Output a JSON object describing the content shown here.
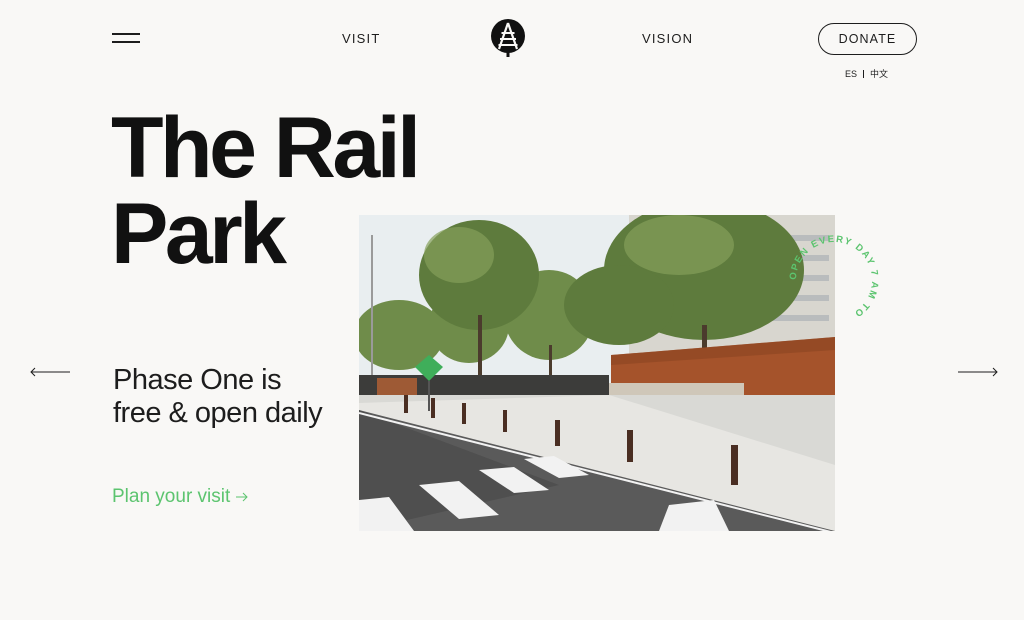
{
  "nav": {
    "visit": "VISIT",
    "vision": "VISION",
    "donate": "DONATE",
    "menu_icon": "hamburger-icon",
    "logo_icon": "rail-park-logo-icon"
  },
  "languages": [
    "ES",
    "中文"
  ],
  "hero": {
    "title_line1": "The Rail",
    "title_line2": "Park",
    "subheading": "Phase One is free & open daily",
    "cta": "Plan your visit"
  },
  "badge": {
    "text": "OPEN EVERY DAY 7 AM TO "
  },
  "colors": {
    "background": "#f9f8f6",
    "text": "#1d1d1d",
    "accent": "#5cc46f"
  },
  "icons": {
    "prev": "arrow-left-icon",
    "next": "arrow-right-icon",
    "cta": "arrow-right-icon"
  }
}
